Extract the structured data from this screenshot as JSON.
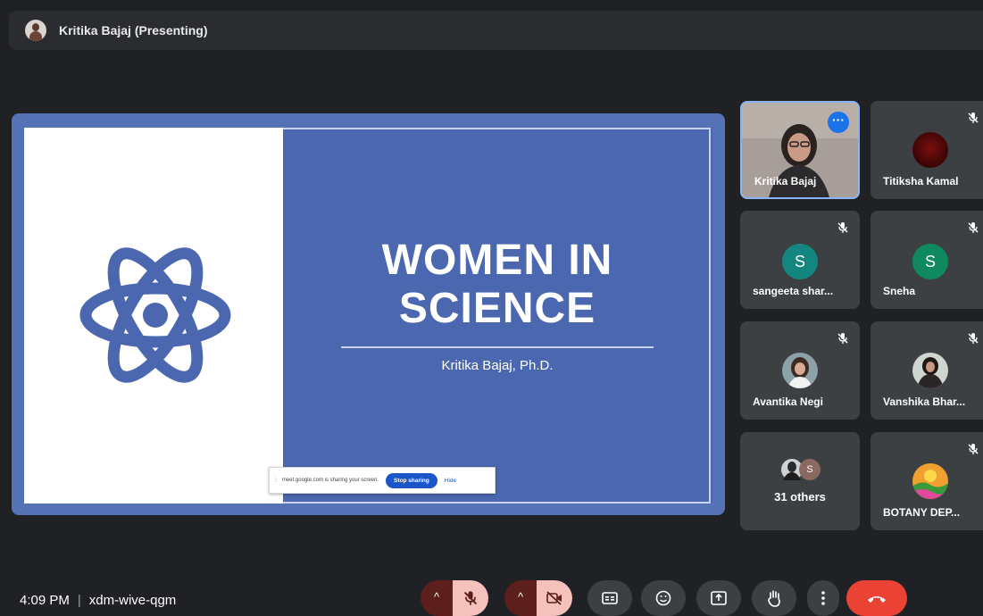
{
  "presenter": {
    "label": "Kritika Bajaj (Presenting)"
  },
  "slide": {
    "title_line1": "WOMEN IN",
    "title_line2": "SCIENCE",
    "subtitle": "Kritika Bajaj, Ph.D.",
    "icon": "atom-icon"
  },
  "share_bar": {
    "text": "meet.google.com is sharing your screen.",
    "stop_label": "Stop sharing",
    "hide_label": "Hide"
  },
  "participants": [
    {
      "name": "Kritika Bajaj",
      "type": "video",
      "mic": "on"
    },
    {
      "name": "Titiksha Kamal",
      "type": "photo",
      "mic": "off"
    },
    {
      "name": "sangeeta shar...",
      "type": "letter",
      "letter": "S",
      "mic": "off"
    },
    {
      "name": "Sneha",
      "type": "letter",
      "letter": "S",
      "mic": "off"
    },
    {
      "name": "Avantika Negi",
      "type": "photo",
      "mic": "off"
    },
    {
      "name": "Vanshika Bhar...",
      "type": "photo",
      "mic": "off"
    },
    {
      "name": "31 others",
      "type": "group",
      "letter": "S"
    },
    {
      "name": "BOTANY DEP...",
      "type": "photo",
      "mic": "off"
    }
  ],
  "bottom_bar": {
    "time": "4:09 PM",
    "meeting_code": "xdm-wive-qgm",
    "separator": "|"
  },
  "controls": [
    "mic-off-icon",
    "camera-off-icon",
    "captions-icon",
    "emoji-icon",
    "present-icon",
    "raise-hand-icon",
    "more-options-icon",
    "end-call-icon"
  ],
  "colors": {
    "background": "#202124",
    "slide_blue": "#4a67af",
    "accent": "#1a73e8",
    "end_call": "#ea4335"
  }
}
